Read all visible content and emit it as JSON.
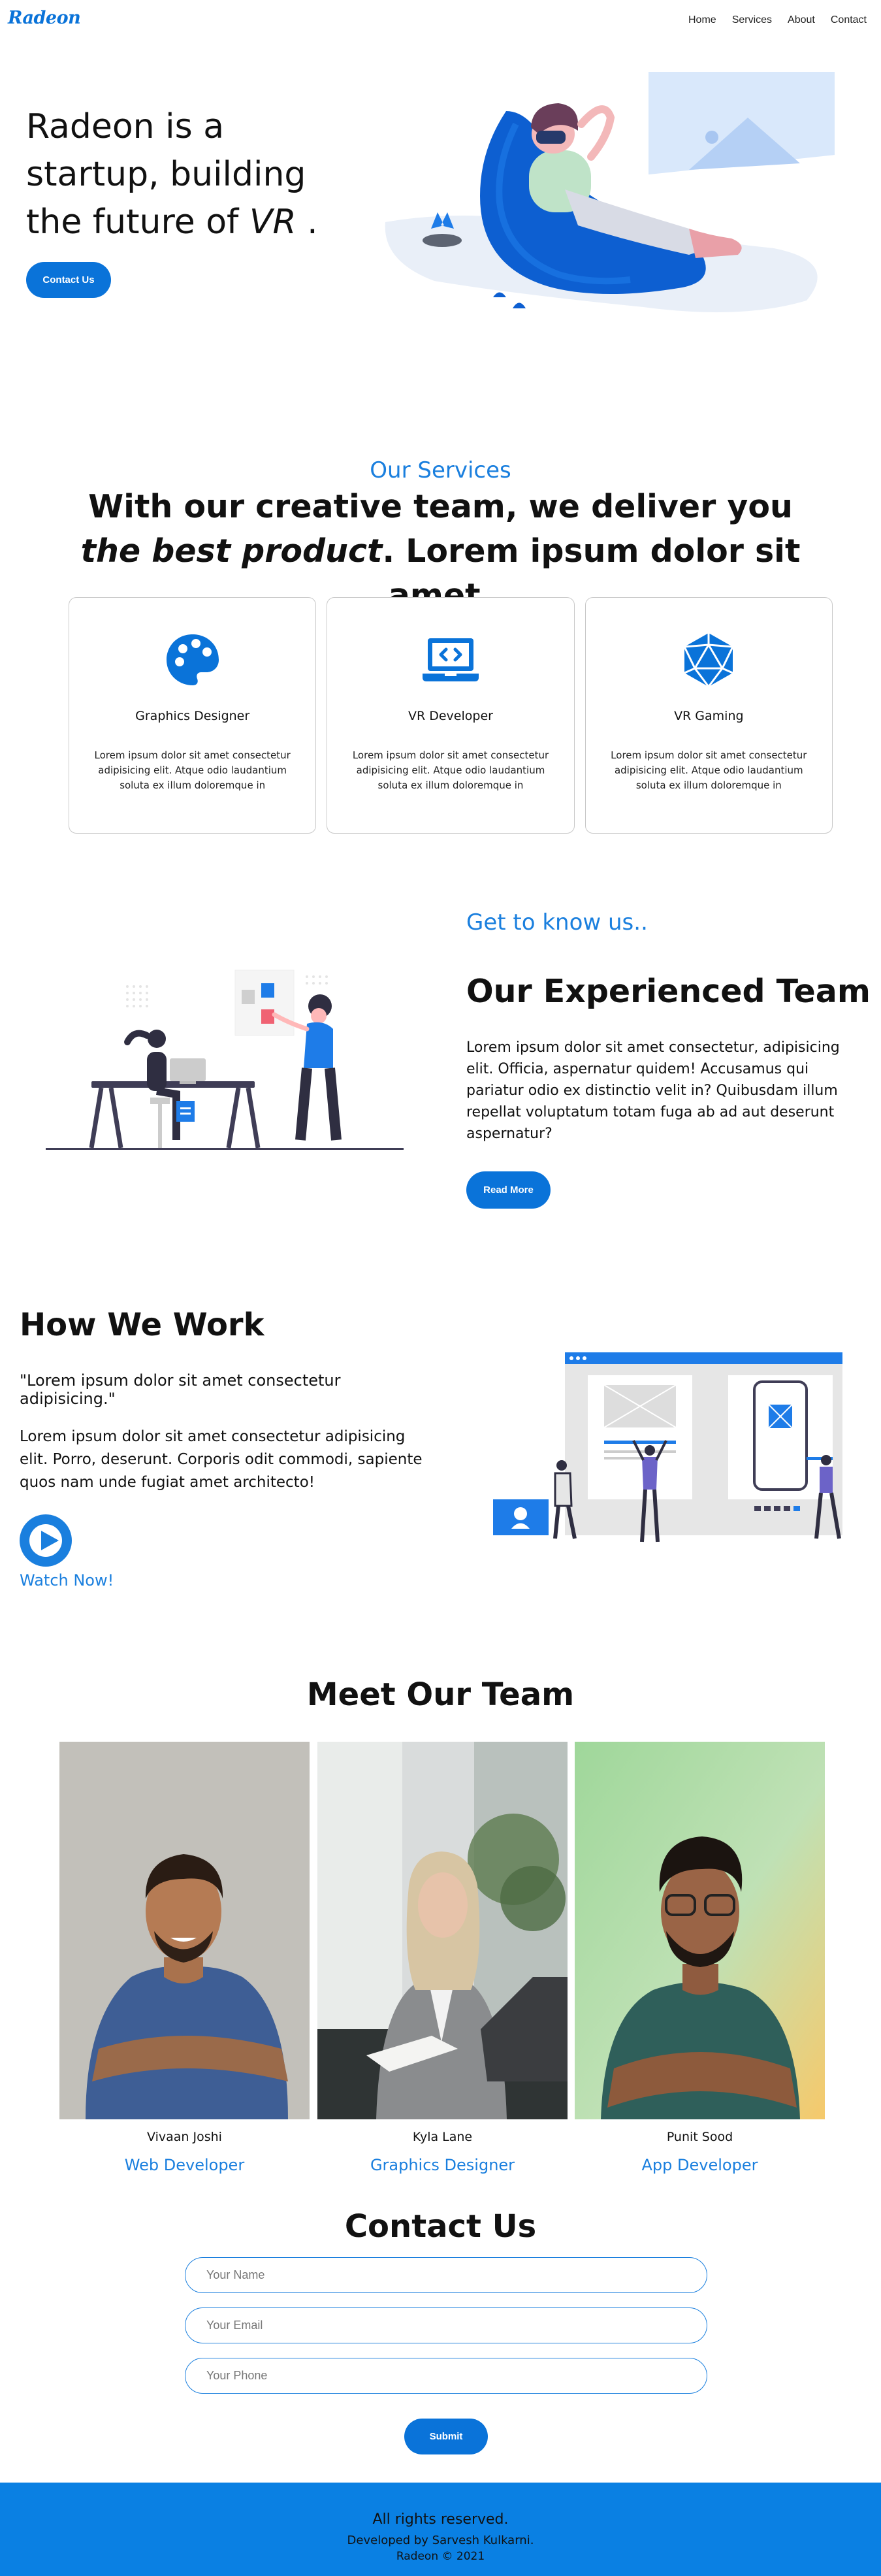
{
  "nav": {
    "logo": "Radeon",
    "links": [
      "Home",
      "Services",
      "About",
      "Contact"
    ]
  },
  "hero": {
    "title_line1": "Radeon is a",
    "title_line2": "startup, building",
    "title_line3_prefix": "the future of ",
    "title_line3_em": "VR",
    "title_line3_suffix": " .",
    "button": "Contact Us"
  },
  "services": {
    "label": "Our Services",
    "heading_line1": "With our creative team, we deliver you",
    "heading_em": "the best product",
    "heading_line2_suffix": ". Lorem ipsum dolor sit amet.",
    "cards": [
      {
        "icon": "palette-icon",
        "title": "Graphics Designer",
        "text": "Lorem ipsum dolor sit amet consectetur adipisicing elit. Atque odio laudantium soluta ex illum doloremque in"
      },
      {
        "icon": "laptop-code-icon",
        "title": "VR Developer",
        "text": "Lorem ipsum dolor sit amet consectetur adipisicing elit. Atque odio laudantium soluta ex illum doloremque in"
      },
      {
        "icon": "dice-d20-icon",
        "title": "VR Gaming",
        "text": "Lorem ipsum dolor sit amet consectetur adipisicing elit. Atque odio laudantium soluta ex illum doloremque in"
      }
    ]
  },
  "about": {
    "label": "Get to know us..",
    "title": "Our Experienced Team",
    "text": "Lorem ipsum dolor sit amet consectetur, adipisicing elit. Officia, aspernatur quidem! Accusamus qui pariatur odio ex distinctio velit in? Quibusdam illum repellat voluptatum totam fuga ab ad aut deserunt aspernatur?",
    "button": "Read More"
  },
  "how": {
    "title": "How We Work",
    "quote": "\"Lorem ipsum dolor sit amet consectetur adipisicing.\"",
    "text": "Lorem ipsum dolor sit amet consectetur adipisicing elit. Porro, deserunt. Corporis odit commodi, sapiente quos nam unde fugiat amet architecto!",
    "watch": "Watch Now!"
  },
  "team": {
    "title": "Meet Our Team",
    "members": [
      {
        "name": "Vivaan Joshi",
        "role": "Web Developer"
      },
      {
        "name": "Kyla Lane",
        "role": "Graphics Designer"
      },
      {
        "name": "Punit Sood",
        "role": "App Developer"
      }
    ]
  },
  "contact": {
    "title": "Contact Us",
    "name_placeholder": "Your Name",
    "email_placeholder": "Your Email",
    "phone_placeholder": "Your Phone",
    "submit": "Submit"
  },
  "footer": {
    "line1": "All rights reserved.",
    "line2": "Developed by Sarvesh Kulkarni.",
    "line3": "Radeon © 2021"
  },
  "colors": {
    "accent": "#0a73d9",
    "footer_bg": "#0a80e3"
  }
}
